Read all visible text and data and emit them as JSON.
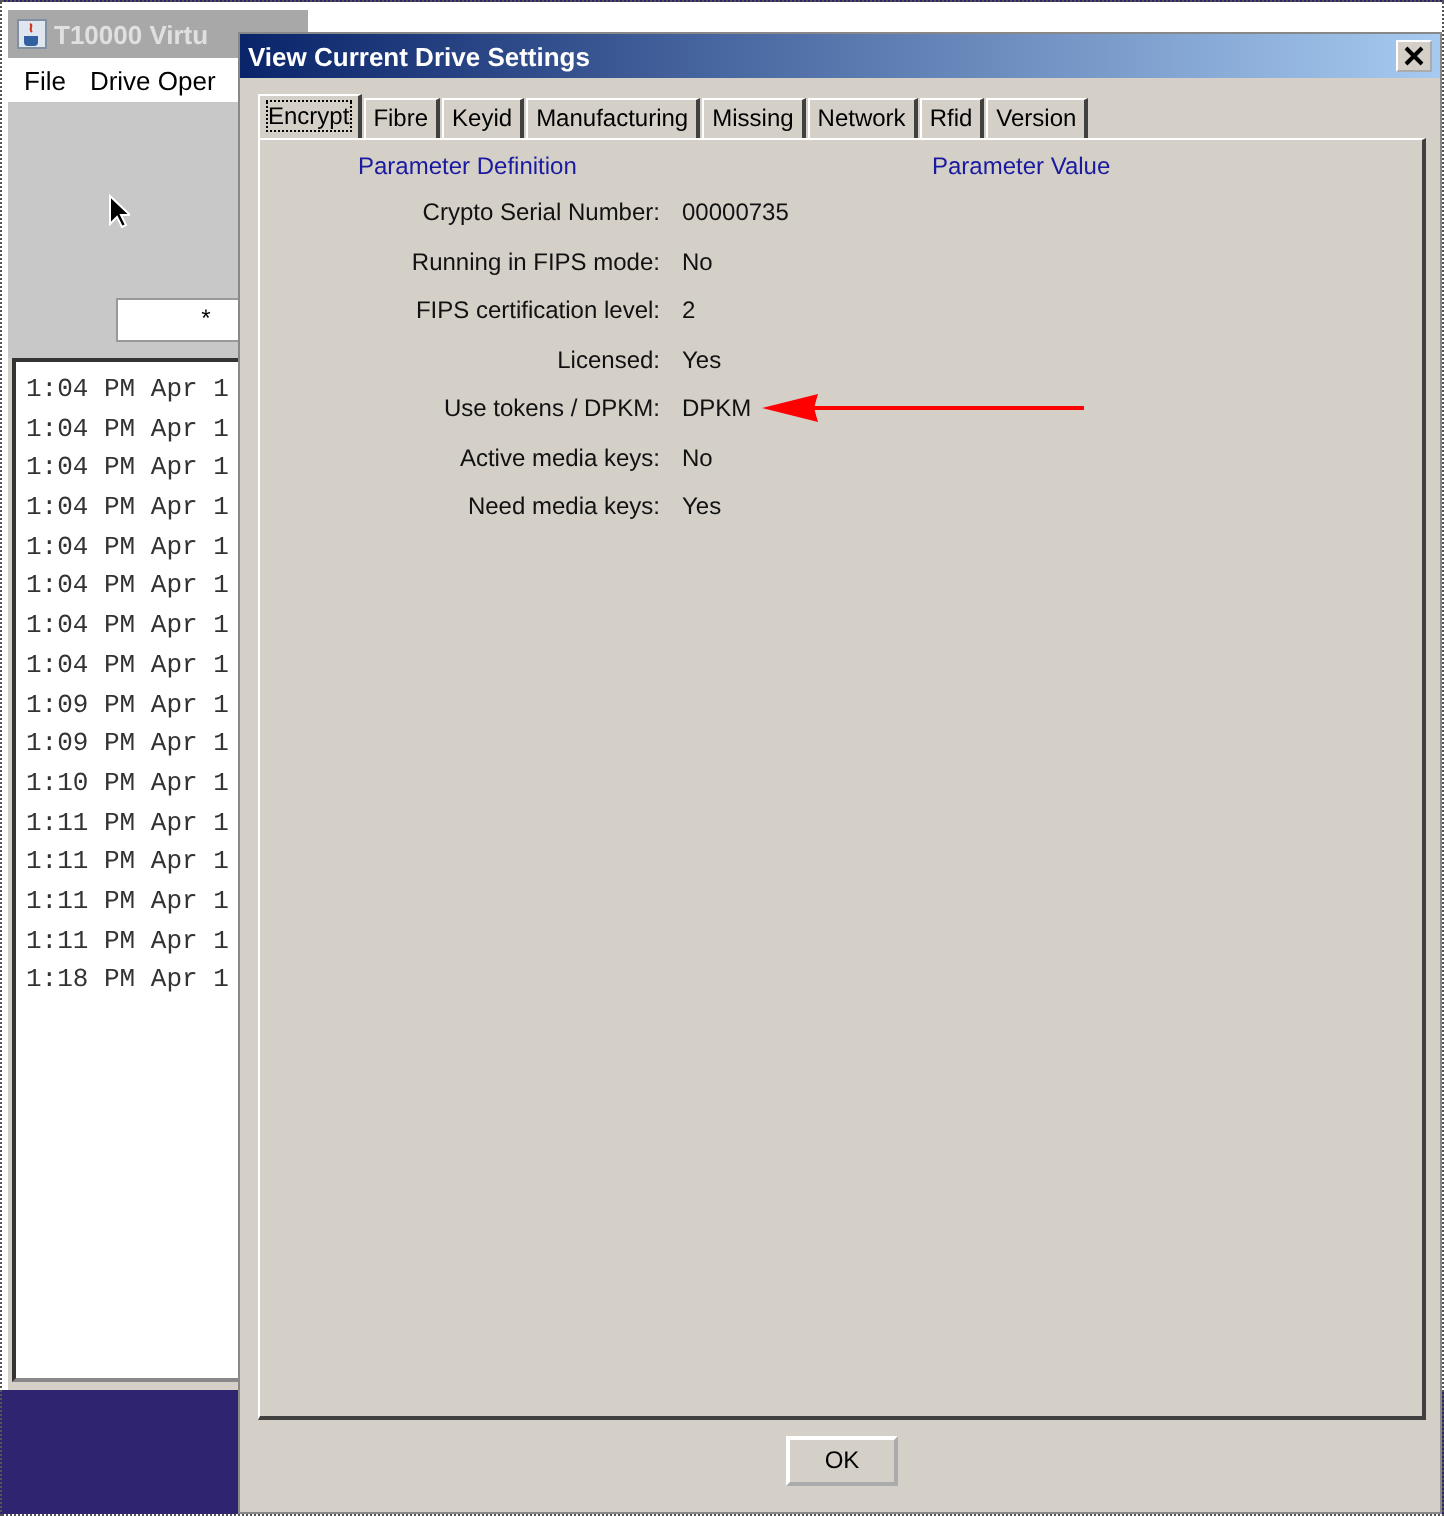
{
  "background_window": {
    "title": "T10000 Virtu",
    "menu": [
      "File",
      "Drive Oper"
    ],
    "field_value": "*",
    "log_lines": [
      "1:04 PM Apr 1",
      "1:04 PM Apr 1",
      "1:04 PM Apr 1",
      "1:04 PM Apr 1",
      "1:04 PM Apr 1",
      "1:04 PM Apr 1",
      "1:04 PM Apr 1",
      "1:04 PM Apr 1",
      "1:09 PM Apr 1",
      "1:09 PM Apr 1",
      "1:10 PM Apr 1",
      "1:11 PM Apr 1",
      "1:11 PM Apr 1",
      "1:11 PM Apr 1",
      "1:11 PM Apr 1",
      "1:18 PM Apr 1"
    ]
  },
  "dialog": {
    "title": "View Current Drive Settings",
    "tabs": [
      {
        "label": "Encrypt",
        "selected": true
      },
      {
        "label": "Fibre",
        "selected": false
      },
      {
        "label": "Keyid",
        "selected": false
      },
      {
        "label": "Manufacturing",
        "selected": false
      },
      {
        "label": "Missing",
        "selected": false
      },
      {
        "label": "Network",
        "selected": false
      },
      {
        "label": "Rfid",
        "selected": false
      },
      {
        "label": "Version",
        "selected": false
      }
    ],
    "columns": [
      "Parameter Definition",
      "Parameter Value"
    ],
    "rows": [
      {
        "label": "Crypto Serial Number:",
        "value": "00000735"
      },
      {
        "label": "Running in FIPS mode:",
        "value": "No"
      },
      {
        "label": "FIPS certification level:",
        "value": "2"
      },
      {
        "label": "Licensed:",
        "value": "Yes"
      },
      {
        "label": "Use tokens / DPKM:",
        "value": "DPKM",
        "highlighted": true
      },
      {
        "label": "Active media keys:",
        "value": "No"
      },
      {
        "label": "Need media keys:",
        "value": "Yes"
      }
    ],
    "buttons": [
      "OK"
    ]
  }
}
